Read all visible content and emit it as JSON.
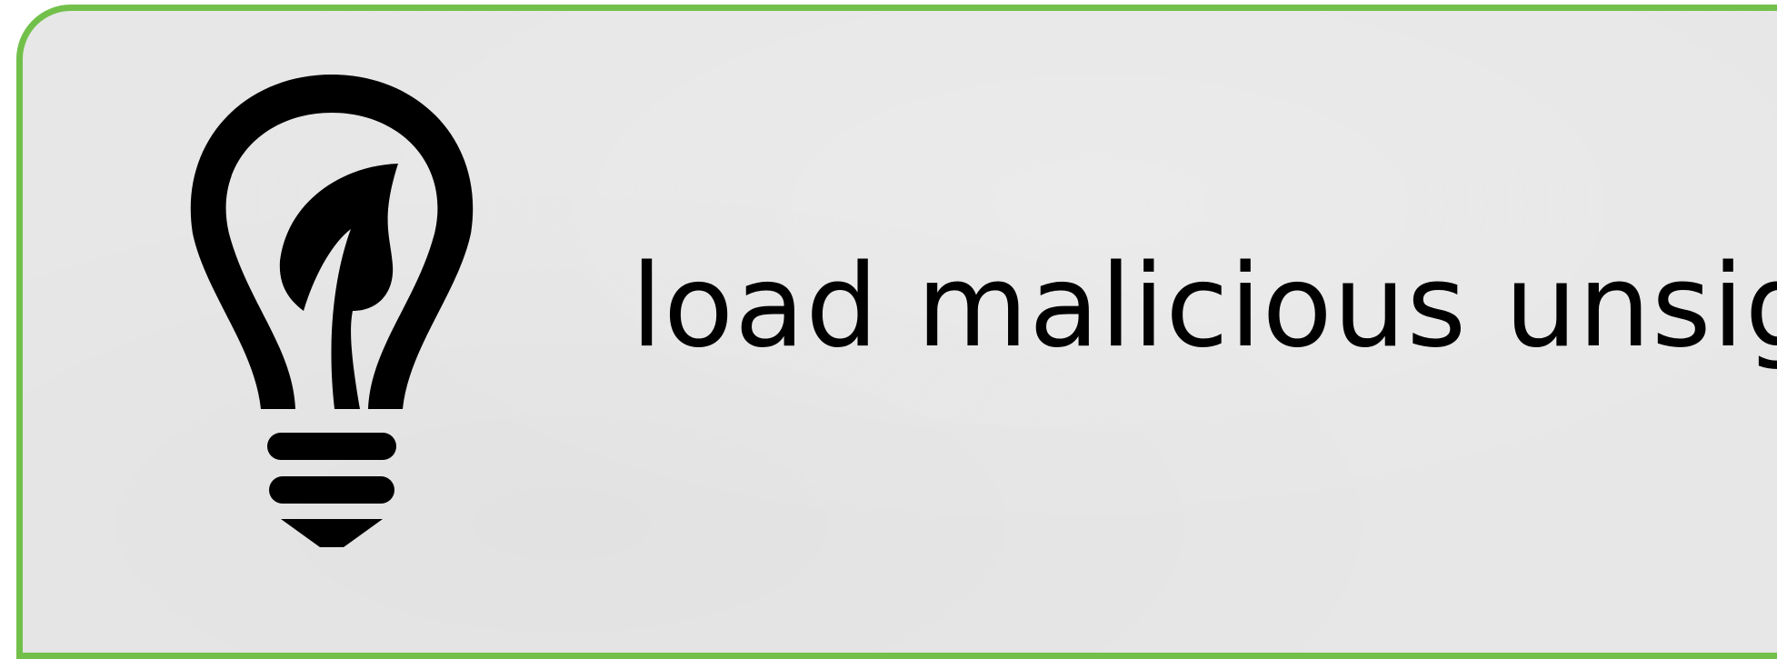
{
  "tip": {
    "text": "load malicious unsig"
  },
  "icon": {
    "name": "lightbulb-leaf-icon"
  },
  "colors": {
    "border": "#72c04a",
    "background": "#e7e7e7",
    "text": "#000000"
  }
}
